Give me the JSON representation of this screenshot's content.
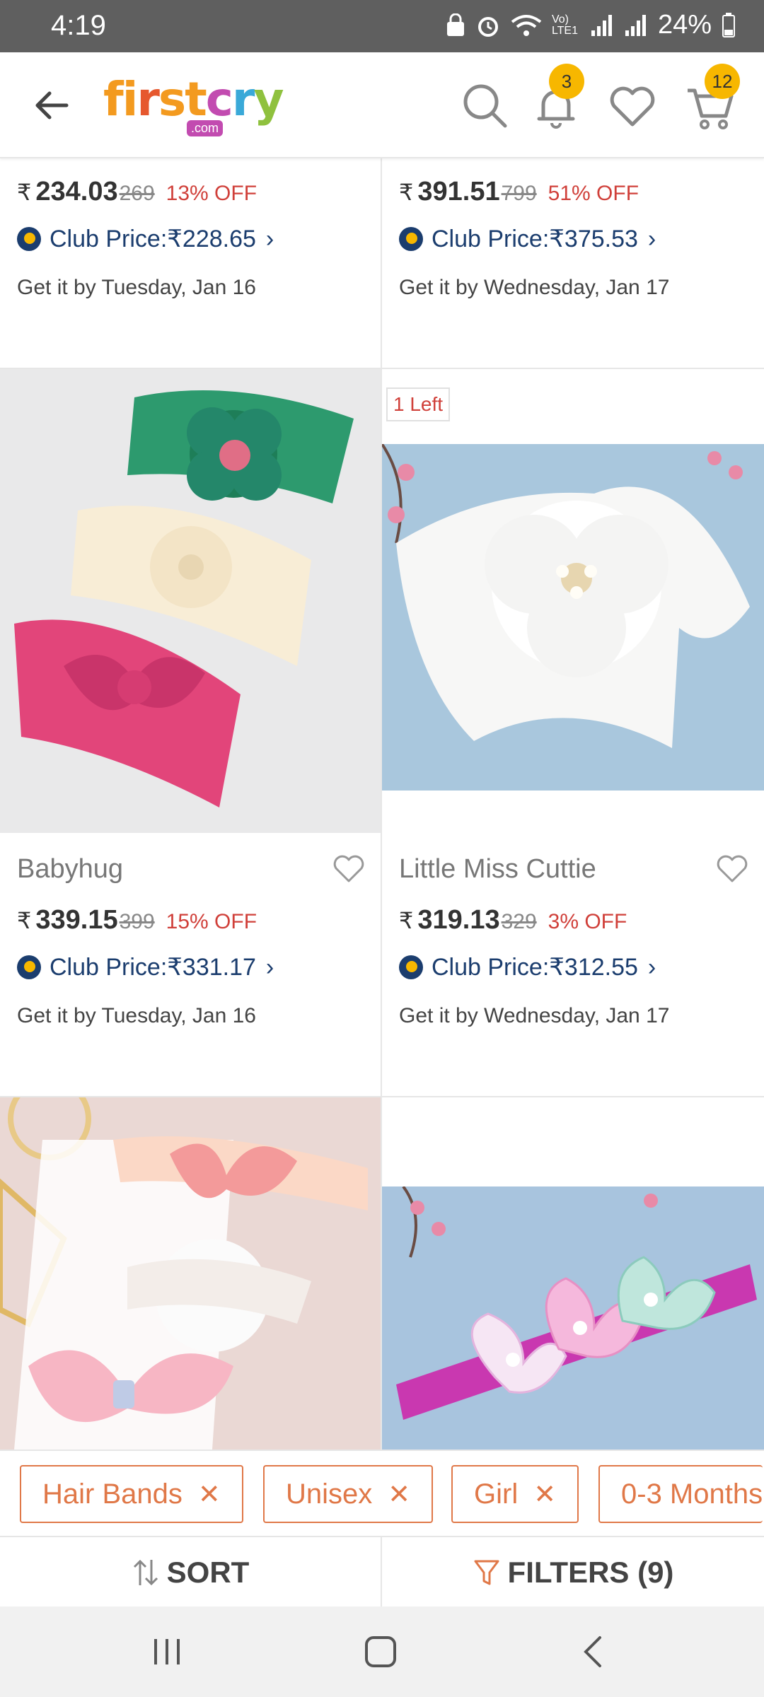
{
  "status_bar": {
    "time": "4:19",
    "battery": "24%",
    "network": "Vo) LTE1"
  },
  "header": {
    "logo_main": "firstcry",
    "logo_sub": ".com",
    "notification_count": "3",
    "cart_count": "12"
  },
  "products": [
    {
      "id": "p1",
      "price": "234.03",
      "mrp": "269",
      "off": "13% OFF",
      "club_price": "Club Price:₹228.65",
      "delivery": "Get it by Tuesday, Jan 16"
    },
    {
      "id": "p2",
      "price": "391.51",
      "mrp": "799",
      "off": "51% OFF",
      "club_price": "Club Price:₹375.53",
      "delivery": "Get it by Wednesday, Jan 17"
    },
    {
      "id": "p3",
      "brand": "Babyhug",
      "price": "339.15",
      "mrp": "399",
      "off": "15% OFF",
      "club_price": "Club Price:₹331.17",
      "delivery": "Get it by Tuesday, Jan 16"
    },
    {
      "id": "p4",
      "brand": "Little Miss Cuttie",
      "price": "319.13",
      "mrp": "329",
      "off": "3% OFF",
      "club_price": "Club Price:₹312.55",
      "delivery": "Get it by Wednesday, Jan 17",
      "stock_badge": "1 Left"
    }
  ],
  "currency": "₹",
  "filters": {
    "chips": [
      "Hair Bands",
      "Unisex",
      "Girl",
      "0-3 Months"
    ]
  },
  "actions": {
    "sort": "SORT",
    "filters": "FILTERS (9)"
  },
  "colors": {
    "accent": "#e07848",
    "discount": "#d0403a",
    "club": "#1b3d6e",
    "badge": "#f7b700"
  }
}
